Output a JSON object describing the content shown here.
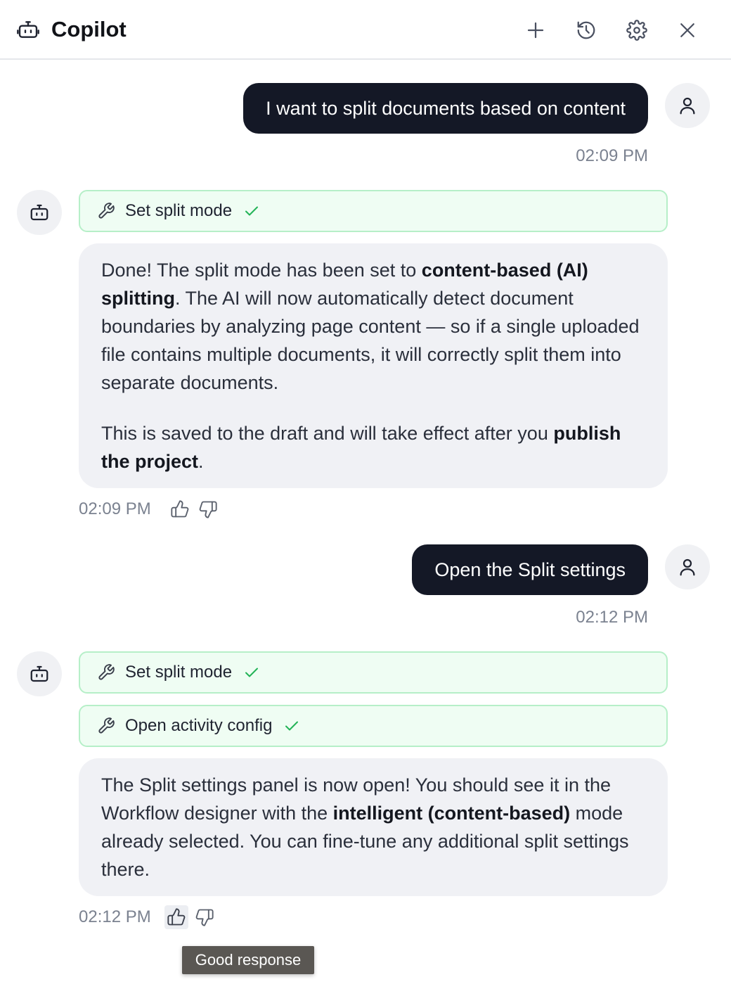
{
  "header": {
    "title": "Copilot",
    "icons": {
      "app": "robot-icon",
      "new_chat": "plus-icon",
      "history": "history-icon",
      "settings": "gear-icon",
      "close": "close-icon"
    }
  },
  "messages": [
    {
      "role": "user",
      "text": "I want to split documents based on content",
      "time": "02:09 PM"
    },
    {
      "role": "assistant",
      "tools": [
        {
          "label": "Set split mode",
          "status": "done"
        }
      ],
      "paragraphs": [
        [
          {
            "text": "Done! The split mode has been set to "
          },
          {
            "text": "content-based (AI) splitting",
            "bold": true
          },
          {
            "text": ". The AI will now automatically detect document boundaries by analyzing page content — so if a single uploaded file contains multiple documents, it will correctly split them into separate documents."
          }
        ],
        [
          {
            "text": "This is saved to the draft and will take effect after you "
          },
          {
            "text": "publish the project",
            "bold": true
          },
          {
            "text": "."
          }
        ]
      ],
      "time": "02:09 PM"
    },
    {
      "role": "user",
      "text": "Open the Split settings",
      "time": "02:12 PM"
    },
    {
      "role": "assistant",
      "tools": [
        {
          "label": "Set split mode",
          "status": "done"
        },
        {
          "label": "Open activity config",
          "status": "done"
        }
      ],
      "paragraphs": [
        [
          {
            "text": "The Split settings panel is now open! You should see it in the Workflow designer with the "
          },
          {
            "text": "intelligent (content-based)",
            "bold": true
          },
          {
            "text": " mode already selected. You can fine-tune any additional split settings there."
          }
        ]
      ],
      "time": "02:12 PM"
    }
  ],
  "tooltip": {
    "text": "Good response"
  },
  "colors": {
    "user_bubble": "#141826",
    "tool_border": "#b6efc8",
    "tool_bg": "#effdf3",
    "check": "#22b356",
    "bot_bubble": "#f0f1f5"
  }
}
